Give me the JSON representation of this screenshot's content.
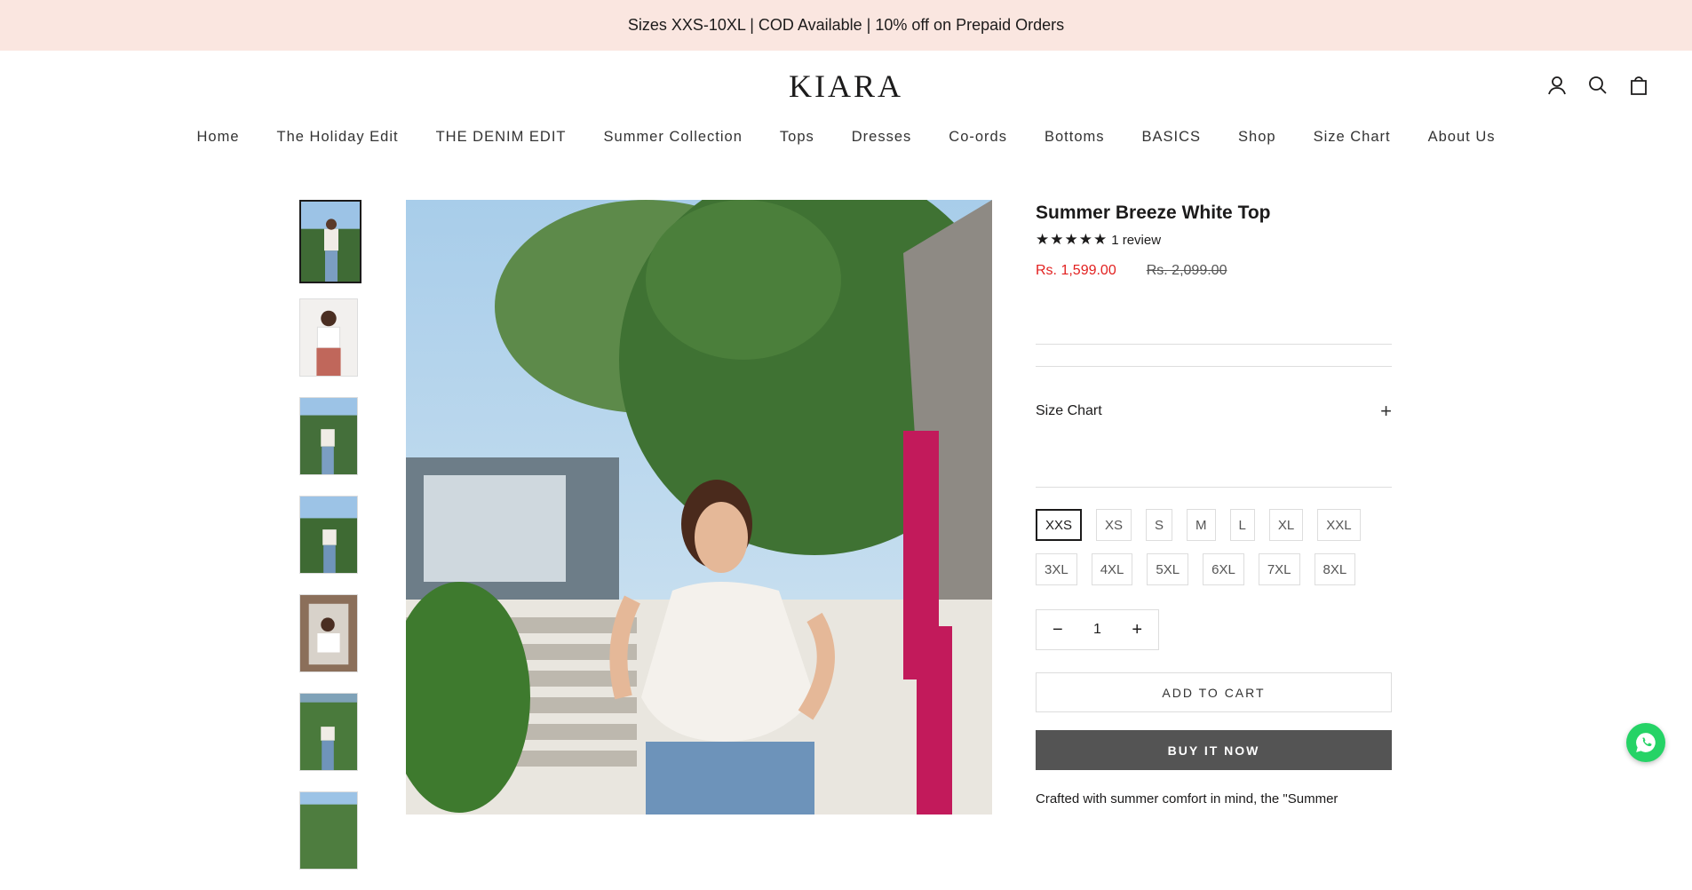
{
  "announcement": "Sizes XXS-10XL | COD Available | 10% off on Prepaid Orders",
  "header": {
    "logo": "KIARA",
    "icons": [
      "account-icon",
      "search-icon",
      "cart-icon"
    ]
  },
  "nav": [
    "Home",
    "The Holiday Edit",
    "THE DENIM EDIT",
    "Summer Collection",
    "Tops",
    "Dresses",
    "Co-ords",
    "Bottoms",
    "BASICS",
    "Shop",
    "Size Chart",
    "About Us"
  ],
  "product": {
    "title": "Summer Breeze White Top",
    "stars": "★★★★★",
    "rating_value": 5,
    "reviews": "1 review",
    "price": "Rs. 1,599.00",
    "compare_price": "Rs. 2,099.00",
    "size_chart_label": "Size Chart",
    "size_chart_toggle": "+",
    "sizes_row1": [
      "XXS",
      "XS",
      "S",
      "M",
      "L",
      "XL",
      "XXL"
    ],
    "sizes_row2": [
      "3XL",
      "4XL",
      "5XL",
      "6XL",
      "7XL",
      "8XL"
    ],
    "selected_size": "XXS",
    "quantity": "1",
    "qty_minus": "−",
    "qty_plus": "+",
    "add_to_cart": "ADD TO CART",
    "buy_now": "BUY IT NOW",
    "description": "Crafted with summer comfort in mind, the \"Summer"
  },
  "thumbnails": 7,
  "colors": {
    "announcement_bg": "#fae6e0",
    "sale_price": "#e22120",
    "buy_now_bg": "#545454",
    "whatsapp": "#25d366"
  }
}
